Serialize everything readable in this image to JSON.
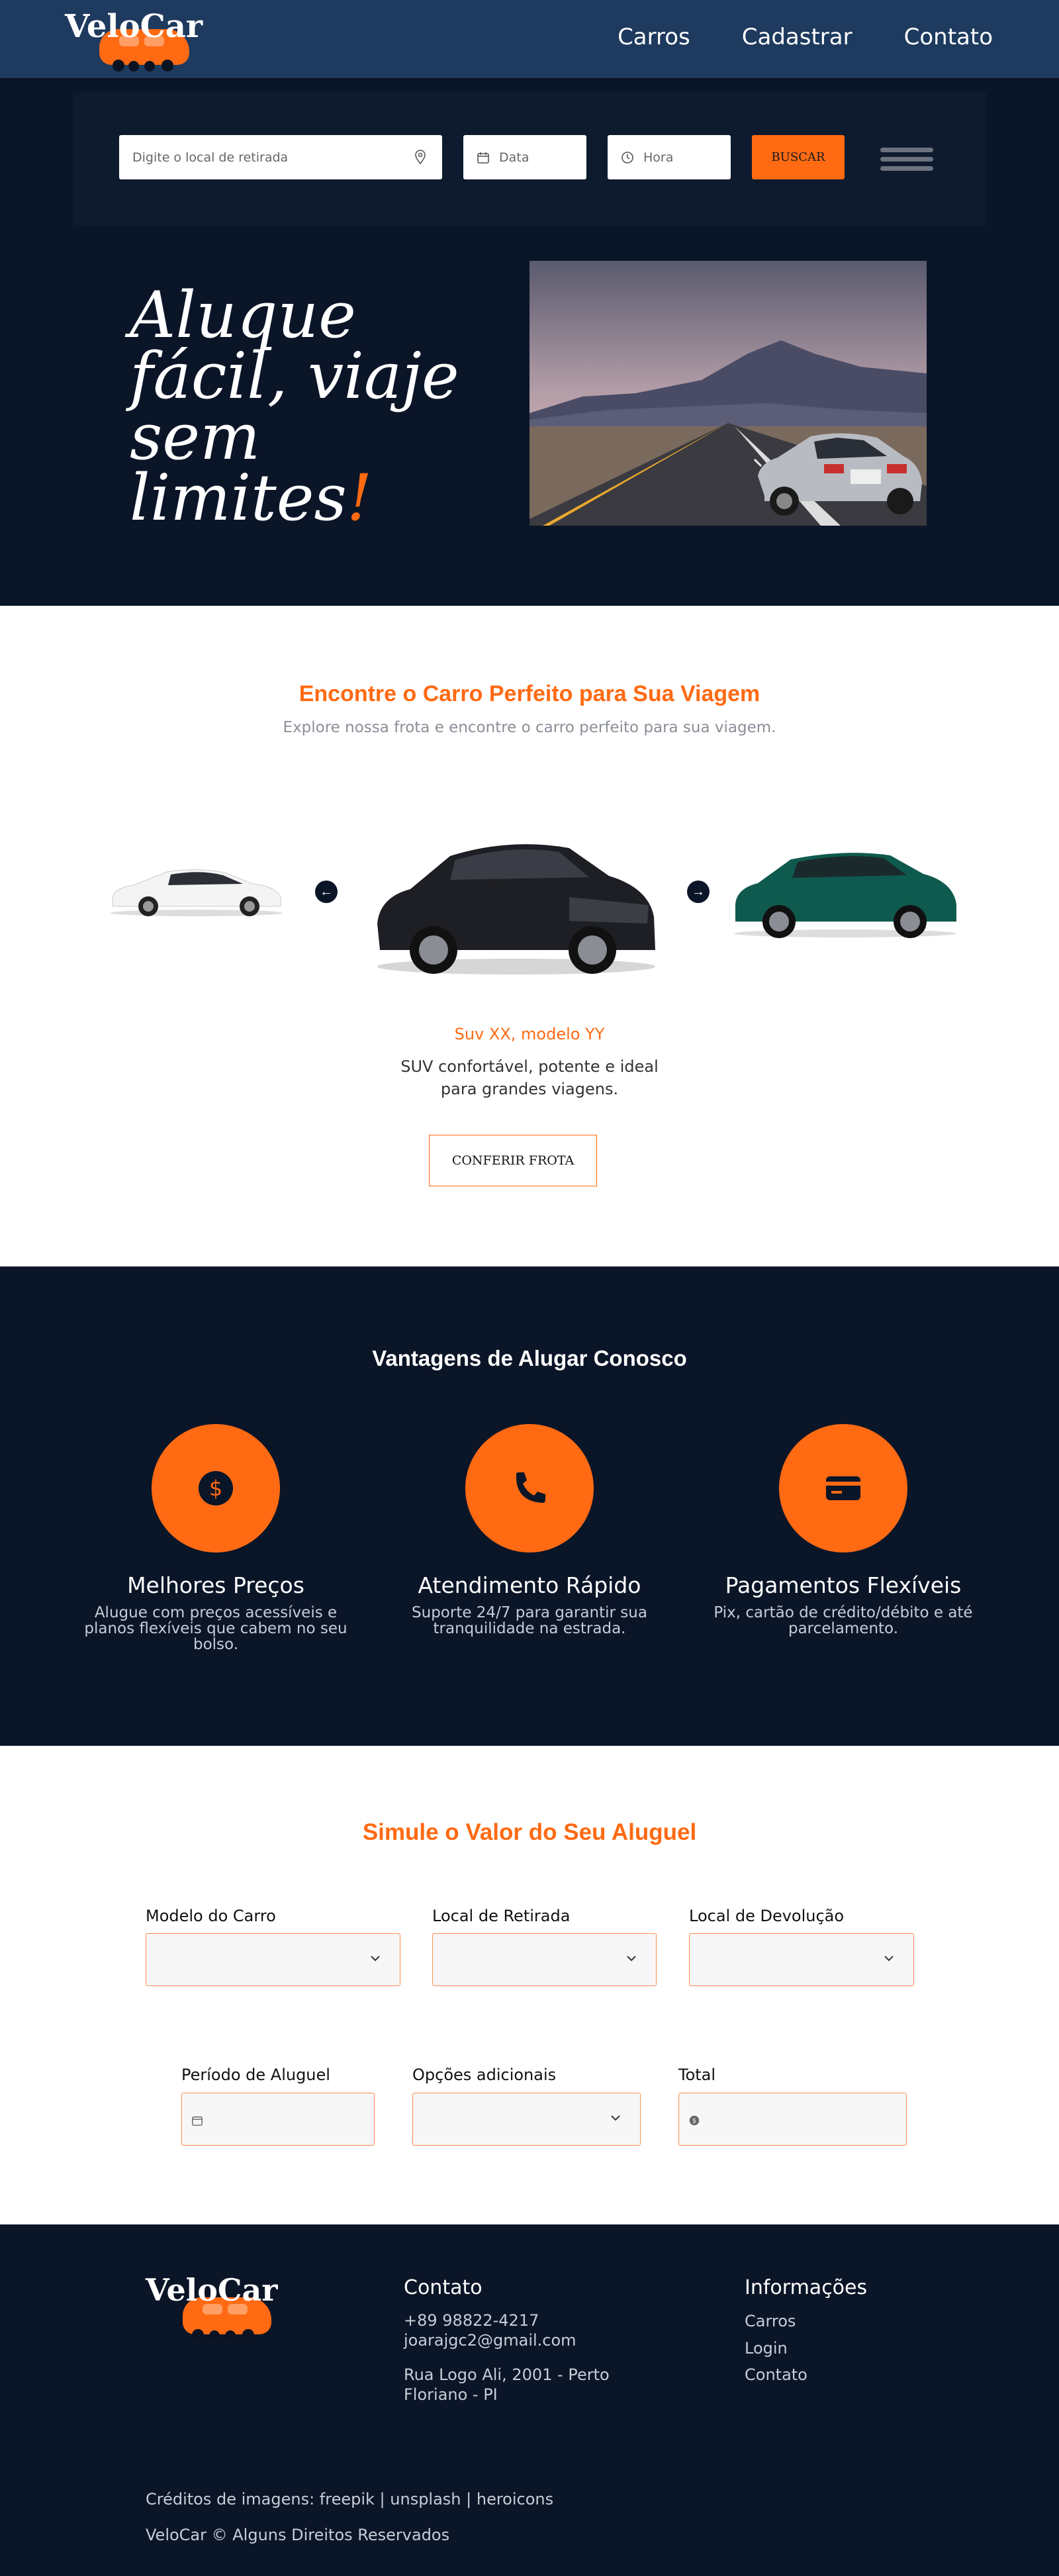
{
  "header": {
    "logo": "VeloCar",
    "nav": [
      "Carros",
      "Cadastrar",
      "Contato"
    ]
  },
  "search": {
    "location_placeholder": "Digite o local de retirada",
    "date_placeholder": "Data",
    "time_placeholder": "Hora",
    "button": "BUSCAR"
  },
  "hero": {
    "line1": "Aluque",
    "line2": "fácil, viaje",
    "line3": "sem",
    "line4": "limites",
    "excl": "!"
  },
  "fleet": {
    "title": "Encontre o Carro Perfeito para Sua Viagem",
    "subtitle": "Explore nossa frota e encontre o carro perfeito para sua viagem.",
    "car_name": "Suv XX, modelo YY",
    "car_desc": "SUV confortável, potente e ideal para grandes viagens.",
    "button": "CONFERIR FROTA"
  },
  "advantages": {
    "title": "Vantagens de Alugar Conosco",
    "items": [
      {
        "title": "Melhores Preços",
        "text": "Alugue com preços acessíveis e planos flexíveis que cabem no seu bolso.",
        "icon": "dollar-icon"
      },
      {
        "title": "Atendimento Rápido",
        "text": "Suporte 24/7 para garantir sua tranquilidade na estrada.",
        "icon": "phone-icon"
      },
      {
        "title": "Pagamentos Flexíveis",
        "text": "Pix, cartão de crédito/débito e até parcelamento.",
        "icon": "credit-card-icon"
      }
    ]
  },
  "simulator": {
    "title": "Simule o Valor do Seu Aluguel",
    "labels": [
      "Modelo do Carro",
      "Local de Retirada",
      "Local de Devolução",
      "Período de Aluguel",
      "Opções adicionais",
      "Total"
    ]
  },
  "footer": {
    "logo": "VeloCar",
    "contact_title": "Contato",
    "phone": "+89 98822-4217",
    "email": "joarajgc2@gmail.com",
    "address": "Rua Logo Ali, 2001 - Perto Floriano - PI",
    "info_title": "Informações",
    "links": [
      "Carros",
      "Login",
      "Contato"
    ],
    "credits": "Créditos de imagens: freepik | unsplash | heroicons",
    "copyright": "VeloCar © Alguns Direitos Reservados"
  },
  "colors": {
    "accent": "#ff6a13",
    "dark": "#0b1528",
    "nav": "#1e3a5f"
  }
}
